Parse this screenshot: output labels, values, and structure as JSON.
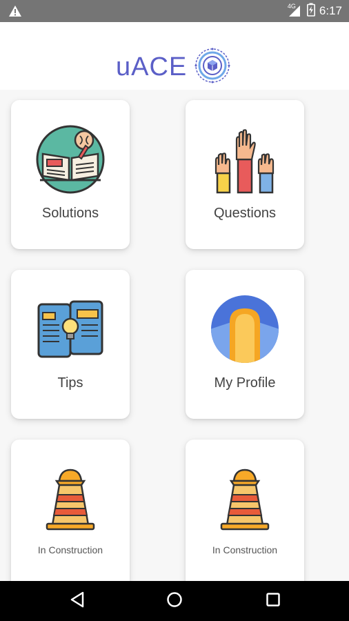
{
  "status_bar": {
    "network": "4G",
    "time": "6:17"
  },
  "header": {
    "logo_text": "uACE"
  },
  "cards": [
    {
      "label": "Solutions",
      "icon": "open-book-brain-icon"
    },
    {
      "label": "Questions",
      "icon": "raised-hands-icon"
    },
    {
      "label": "Tips",
      "icon": "tip-phones-lightbulb-icon"
    },
    {
      "label": "My Profile",
      "icon": "user-avatar-icon"
    },
    {
      "label": "In Construction",
      "icon": "construction-cone-icon"
    },
    {
      "label": "In Construction",
      "icon": "construction-cone-icon"
    }
  ],
  "nav": {
    "back_icon": "back-triangle-icon",
    "home_icon": "home-circle-icon",
    "recents_icon": "recents-square-icon"
  },
  "colors": {
    "brand": "#5b5fc7",
    "status_bar": "#757575",
    "background": "#f7f7f7"
  }
}
